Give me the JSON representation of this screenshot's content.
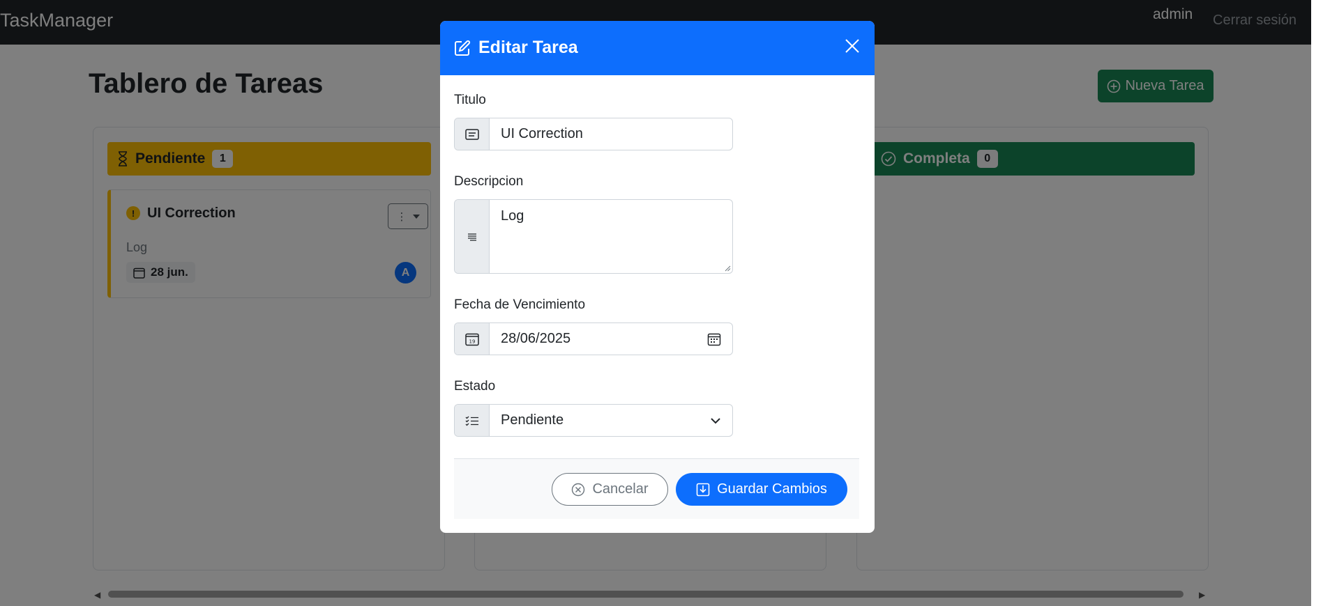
{
  "navbar": {
    "brand": "TaskManager",
    "user": "admin",
    "logout": "Cerrar sesión"
  },
  "page": {
    "title": "Tablero de Tareas",
    "new_task_label": "Nueva Tarea"
  },
  "columns": [
    {
      "name": "Pendiente",
      "count": "1",
      "color": "#ffc107"
    },
    {
      "name": "Completa",
      "count": "0",
      "color": "#198754"
    }
  ],
  "task": {
    "title": "UI Correction",
    "description": "Log",
    "due": "28 jun.",
    "assignee_initial": "A"
  },
  "modal": {
    "title": "Editar Tarea",
    "fields": {
      "titulo": {
        "label": "Titulo",
        "value": "UI Correction"
      },
      "descripcion": {
        "label": "Descripcion",
        "value": "Log"
      },
      "fecha": {
        "label": "Fecha de Vencimiento",
        "value": "28/06/2025"
      },
      "estado": {
        "label": "Estado",
        "value": "Pendiente"
      }
    },
    "cancel_label": "Cancelar",
    "save_label": "Guardar Cambios"
  },
  "colors": {
    "primary": "#0d6efd",
    "success": "#198754",
    "warning": "#ffc107",
    "dark": "#212529"
  }
}
